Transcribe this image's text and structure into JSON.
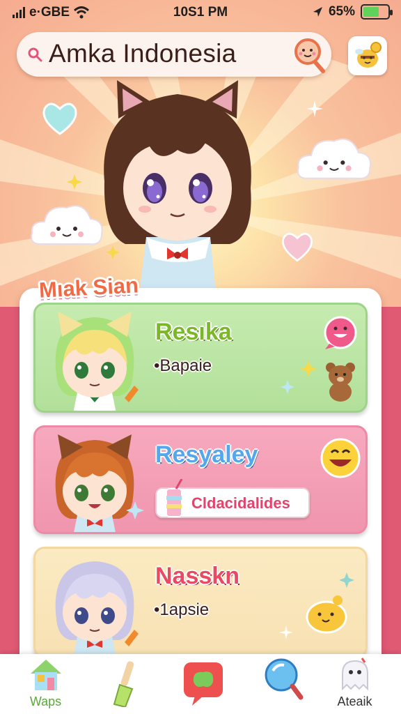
{
  "status_bar": {
    "carrier": "e·GBE",
    "time": "10S1 PM",
    "battery": "65%",
    "battery_level": 0.65
  },
  "search": {
    "query": "Amka Indonesia"
  },
  "section": {
    "title": "Mıak Sian"
  },
  "cards": [
    {
      "name": "Resıka",
      "subtitle": "•Bapaie",
      "color": "#c6ebb0"
    },
    {
      "name": "Resyaley",
      "tag": "Cldacidalides",
      "color": "#f7a9be"
    },
    {
      "name": "Nasskn",
      "subtitle": "•1apsie",
      "color": "#fbeac2"
    }
  ],
  "nav": [
    {
      "label": "Waps",
      "icon": "house-icon",
      "active": true
    },
    {
      "label": "",
      "icon": "brush-icon"
    },
    {
      "label": "",
      "icon": "chat-icon"
    },
    {
      "label": "",
      "icon": "magnifier-icon"
    },
    {
      "label": "Ateaik",
      "icon": "ghost-icon"
    }
  ],
  "colors": {
    "top_bg": "#f7a98b",
    "bottom_bg": "#e05a74",
    "accent": "#f06b45"
  }
}
